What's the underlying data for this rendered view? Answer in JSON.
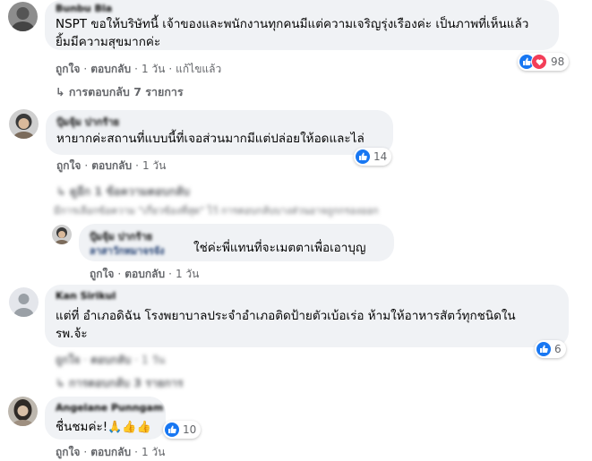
{
  "comments": [
    {
      "name": "Bunbu Bla",
      "line1": "NSPT ขอให้บริษัทนี้ เจ้าของและพนักงานทุกคนมีแต่ความเจริญรุ่งเรืองค่ะ เป็นภาพที่เห็นแล้ว",
      "line2": "ยิ้มมีความสุขมากค่ะ",
      "reactions": "98",
      "like": "ถูกใจ",
      "reply": "ตอบกลับ",
      "time": "1 วัน",
      "edited": "แก้ไขแล้ว",
      "replies": "การตอบกลับ 7 รายการ"
    },
    {
      "name": "ปุ้มจุ้ม ปากร้าย",
      "line1": "หายากค่ะสถานที่แบบนี้ที่เจอส่วนมากมีแต่ปล่อยให้อดและไล่",
      "reactions": "14",
      "like": "ถูกใจ",
      "reply": "ตอบกลับ",
      "time": "1 วัน",
      "replies": "ดูอีก 1 ข้อความตอบกลับ",
      "notice": "มีการเลือกข้อความ \"เกี่ยวข้องที่สุด\" ไว้ การตอบกลับบางส่วนอาจถูกกรองออก"
    },
    {
      "name": "ปุ้มจุ้ม ปากร้าย",
      "tag": "ลาสาวักหมาจรจัง",
      "line1": "ใช่ค่ะพี่แทนที่จะเมตตาเพื่อเอาบุญ",
      "like": "ถูกใจ",
      "reply": "ตอบกลับ",
      "time": "1 วัน"
    },
    {
      "name": "Kan Sirikul",
      "line1": "แต่ที่ อำเภอดิฉัน โรงพยาบาลประจำอำเภอติดป้ายตัวเบ้อเร่อ ห้ามให้อาหารสัตว์ทุกชนิดใน",
      "line2": "รพ.จ้ะ",
      "reactions": "6",
      "like": "ถูกใจ",
      "reply": "ตอบกลับ",
      "time": "1 วัน",
      "replies": "การตอบกลับ 3 รายการ"
    },
    {
      "name": "Angelane Punngam",
      "line1": "ชื่นชมค่ะ!",
      "emoji": "🙏👍👍",
      "reactions": "10",
      "like": "ถูกใจ",
      "reply": "ตอบกลับ",
      "time": "1 วัน"
    }
  ],
  "colors": {
    "like_blue": "#1877f2",
    "love_red": "#f33e58",
    "bubble": "#f0f2f5",
    "muted": "#65676b"
  },
  "icons": [
    "like-icon",
    "love-icon",
    "reply-arrow-icon",
    "avatar"
  ]
}
